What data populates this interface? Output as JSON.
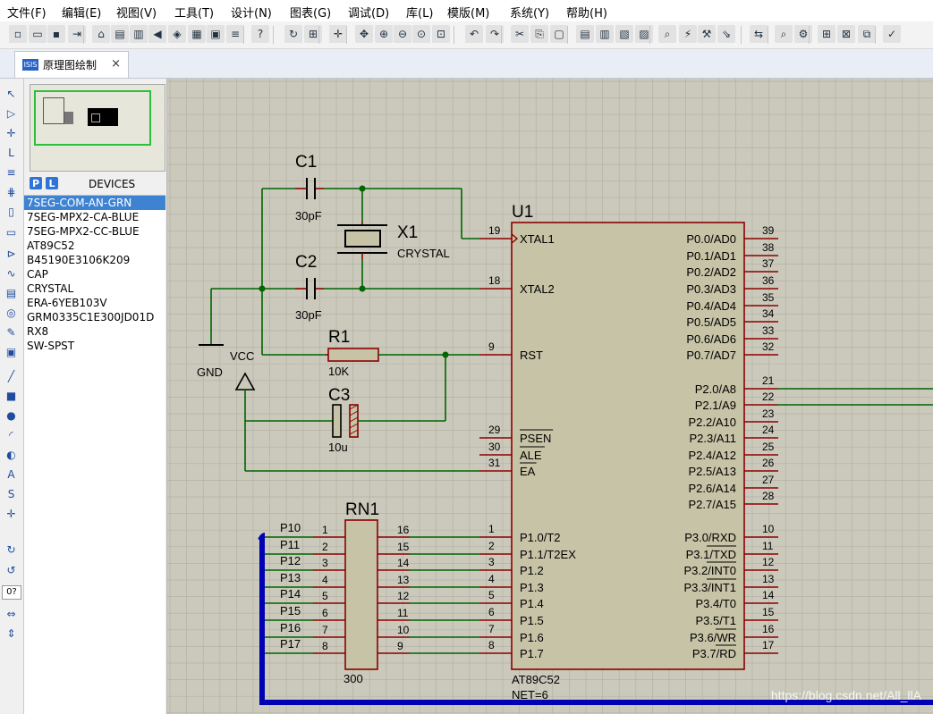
{
  "menu": [
    "文件(F)",
    "编辑(E)",
    "视图(V)",
    "工具(T)",
    "设计(N)",
    "图表(G)",
    "调试(D)",
    "库(L)",
    "模版(M)",
    "系统(Y)",
    "帮助(H)"
  ],
  "tab": {
    "logo": "ISIS",
    "label": "原理图绘制",
    "close": "×"
  },
  "devices": {
    "title": "DEVICES",
    "p_btn": "P",
    "l_btn": "L",
    "items": [
      "7SEG-COM-AN-GRN",
      "7SEG-MPX2-CA-BLUE",
      "7SEG-MPX2-CC-BLUE",
      "AT89C52",
      "B45190E3106K209",
      "CAP",
      "CRYSTAL",
      "ERA-6YEB103V",
      "GRM0335C1E300JD01D",
      "RX8",
      "SW-SPST"
    ],
    "selected_index": 0
  },
  "left_tools": {
    "rotation_field": "0?"
  },
  "schematic": {
    "c1": {
      "ref": "C1",
      "value": "30pF"
    },
    "c2": {
      "ref": "C2",
      "value": "30pF"
    },
    "x1": {
      "ref": "X1",
      "value": "CRYSTAL"
    },
    "r1": {
      "ref": "R1",
      "value": "10K"
    },
    "c3": {
      "ref": "C3",
      "value": "10u"
    },
    "gnd": "GND",
    "vcc": "VCC",
    "u1": {
      "ref": "U1",
      "part": "AT89C52",
      "net_text": "NET=6"
    },
    "rn1": {
      "ref": "RN1",
      "value": "300"
    },
    "u1_left_pins": [
      {
        "num": "19",
        "name": "XTAL1"
      },
      {
        "num": "18",
        "name": "XTAL2"
      },
      {
        "num": "9",
        "name": "RST"
      },
      {
        "num": "29",
        "name": "PSEN"
      },
      {
        "num": "30",
        "name": "ALE"
      },
      {
        "num": "31",
        "name": "EA"
      },
      {
        "num": "1",
        "name": "P1.0/T2"
      },
      {
        "num": "2",
        "name": "P1.1/T2EX"
      },
      {
        "num": "3",
        "name": "P1.2"
      },
      {
        "num": "4",
        "name": "P1.3"
      },
      {
        "num": "5",
        "name": "P1.4"
      },
      {
        "num": "6",
        "name": "P1.5"
      },
      {
        "num": "7",
        "name": "P1.6"
      },
      {
        "num": "8",
        "name": "P1.7"
      }
    ],
    "u1_right_pins": [
      {
        "num": "39",
        "name": "P0.0/AD0"
      },
      {
        "num": "38",
        "name": "P0.1/AD1"
      },
      {
        "num": "37",
        "name": "P0.2/AD2"
      },
      {
        "num": "36",
        "name": "P0.3/AD3"
      },
      {
        "num": "35",
        "name": "P0.4/AD4"
      },
      {
        "num": "34",
        "name": "P0.5/AD5"
      },
      {
        "num": "33",
        "name": "P0.6/AD6"
      },
      {
        "num": "32",
        "name": "P0.7/AD7"
      },
      {
        "num": "21",
        "name": "P2.0/A8"
      },
      {
        "num": "22",
        "name": "P2.1/A9"
      },
      {
        "num": "23",
        "name": "P2.2/A10"
      },
      {
        "num": "24",
        "name": "P2.3/A11"
      },
      {
        "num": "25",
        "name": "P2.4/A12"
      },
      {
        "num": "26",
        "name": "P2.5/A13"
      },
      {
        "num": "27",
        "name": "P2.6/A14"
      },
      {
        "num": "28",
        "name": "P2.7/A15"
      },
      {
        "num": "10",
        "name": "P3.0/RXD"
      },
      {
        "num": "11",
        "name": "P3.1/TXD"
      },
      {
        "num": "12",
        "name": "P3.2/INT0"
      },
      {
        "num": "13",
        "name": "P3.3/INT1"
      },
      {
        "num": "14",
        "name": "P3.4/T0"
      },
      {
        "num": "15",
        "name": "P3.5/T1"
      },
      {
        "num": "16",
        "name": "P3.6/WR"
      },
      {
        "num": "17",
        "name": "P3.7/RD"
      }
    ],
    "rn1_pins": [
      {
        "left": "1",
        "right": "16",
        "net": "P10"
      },
      {
        "left": "2",
        "right": "15",
        "net": "P11"
      },
      {
        "left": "3",
        "right": "14",
        "net": "P12"
      },
      {
        "left": "4",
        "right": "13",
        "net": "P13"
      },
      {
        "left": "5",
        "right": "12",
        "net": "P14"
      },
      {
        "left": "6",
        "right": "11",
        "net": "P15"
      },
      {
        "left": "7",
        "right": "10",
        "net": "P16"
      },
      {
        "left": "8",
        "right": "9",
        "net": "P17"
      }
    ],
    "watermark": "https://blog.csdn.net/All_llA"
  }
}
